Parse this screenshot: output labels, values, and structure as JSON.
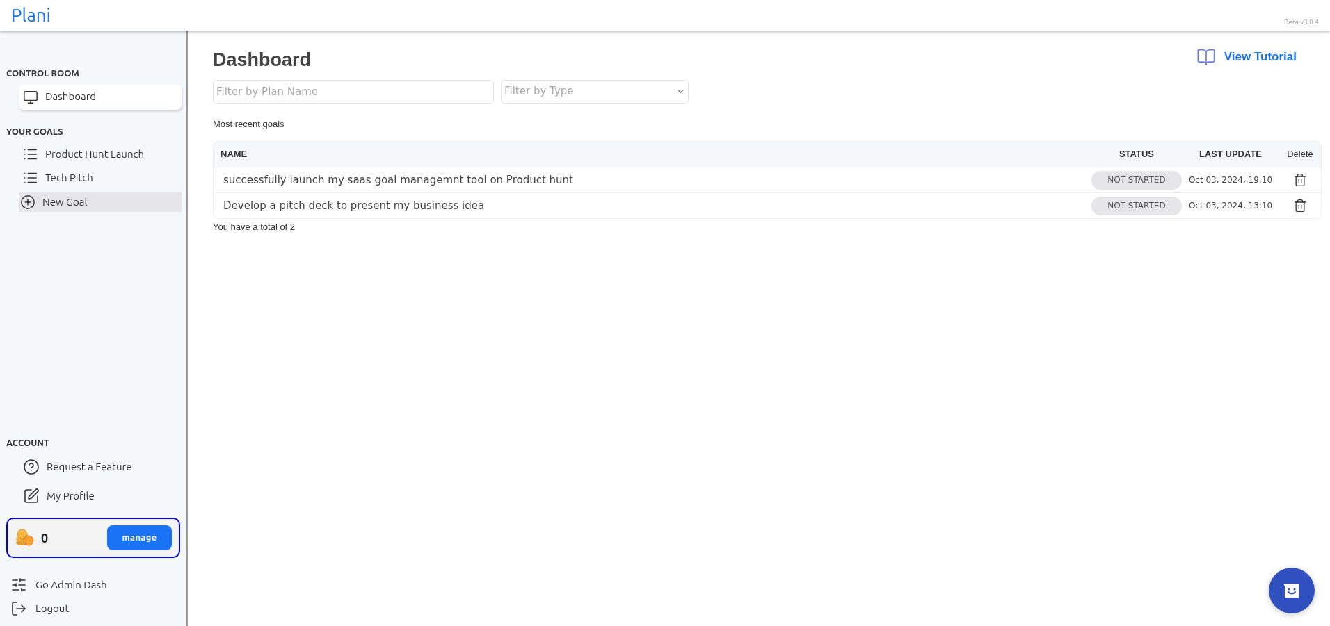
{
  "header": {
    "logo": "Plani",
    "version": "Beta v3.0.4"
  },
  "sidebar": {
    "sections": [
      {
        "title": "CONTROL ROOM",
        "items": [
          {
            "label": "Dashboard",
            "kind": "monitor",
            "selected": true
          }
        ]
      },
      {
        "title": "YOUR GOALS",
        "items": [
          {
            "label": "Product Hunt Launch",
            "kind": "list",
            "selected": false
          },
          {
            "label": "Tech Pitch",
            "kind": "list",
            "selected": false
          },
          {
            "label": "New Goal",
            "kind": "add",
            "selected": false
          }
        ]
      }
    ],
    "account": {
      "title": "ACCOUNT",
      "items": [
        {
          "label": "Request a Feature",
          "kind": "help"
        },
        {
          "label": "My Profile",
          "kind": "edit"
        }
      ]
    },
    "coins": {
      "amount": "0",
      "button": "manage"
    },
    "footer_items": [
      {
        "label": "Go Admin Dash",
        "kind": "sliders"
      },
      {
        "label": "Logout",
        "kind": "logout"
      }
    ]
  },
  "main": {
    "title": "Dashboard",
    "tutorial_link": "View Tutorial",
    "filters": {
      "name_placeholder": "Filter by Plan Name",
      "type_placeholder": "Filter by Type"
    },
    "subtitle": "Most recent goals",
    "table": {
      "columns": [
        "NAME",
        "STATUS",
        "LAST UPDATE",
        "Delete"
      ],
      "rows": [
        {
          "name": "successfully launch my saas goal managemnt tool on Product hunt",
          "status": "NOT STARTED",
          "updated": "Oct 03, 2024, 19:10"
        },
        {
          "name": "Develop a pitch deck to present my business idea",
          "status": "NOT STARTED",
          "updated": "Oct 03, 2024, 13:10"
        }
      ]
    },
    "total": "You have a total of 2"
  }
}
